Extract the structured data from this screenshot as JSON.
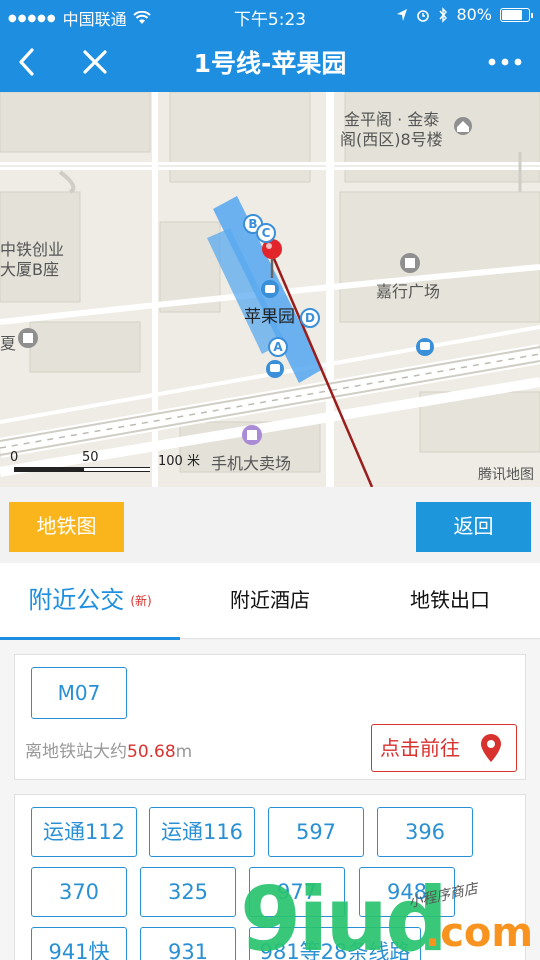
{
  "status": {
    "carrier": "中国联通",
    "time": "下午5:23",
    "battery": "80%",
    "battery_level": 0.8
  },
  "nav": {
    "title": "1号线-苹果园"
  },
  "map": {
    "labels": {
      "jinping": "金平阁 · 金泰",
      "jinping2": "阁(西区)8号楼",
      "zhongtie": "中铁创业",
      "zhongtie2": "大厦B座",
      "xia": "夏",
      "jiaxing": "嘉行广场",
      "station": "苹果园",
      "phone": "手机大卖场"
    },
    "scale_0": "0",
    "scale_50": "50",
    "scale_100": "100 米",
    "credit": "腾讯地图",
    "exits": [
      "B",
      "C",
      "D",
      "A"
    ]
  },
  "buttons": {
    "subway_map": "地铁图",
    "back": "返回"
  },
  "tabs": {
    "bus": "附近公交",
    "bus_new": "(新)",
    "hotel": "附近酒店",
    "exit": "地铁出口"
  },
  "stop": {
    "name": "M07",
    "distance_prefix": "离地铁站大约",
    "distance_value": "50.68",
    "distance_unit": "m",
    "go": "点击前往"
  },
  "routes": [
    "运通112",
    "运通116",
    "597",
    "396",
    "370",
    "325",
    "977",
    "948",
    "941快",
    "931",
    "981等28条线路"
  ],
  "watermark": {
    "main": "9iud",
    "com": ".com",
    "small": "小程序商店"
  }
}
